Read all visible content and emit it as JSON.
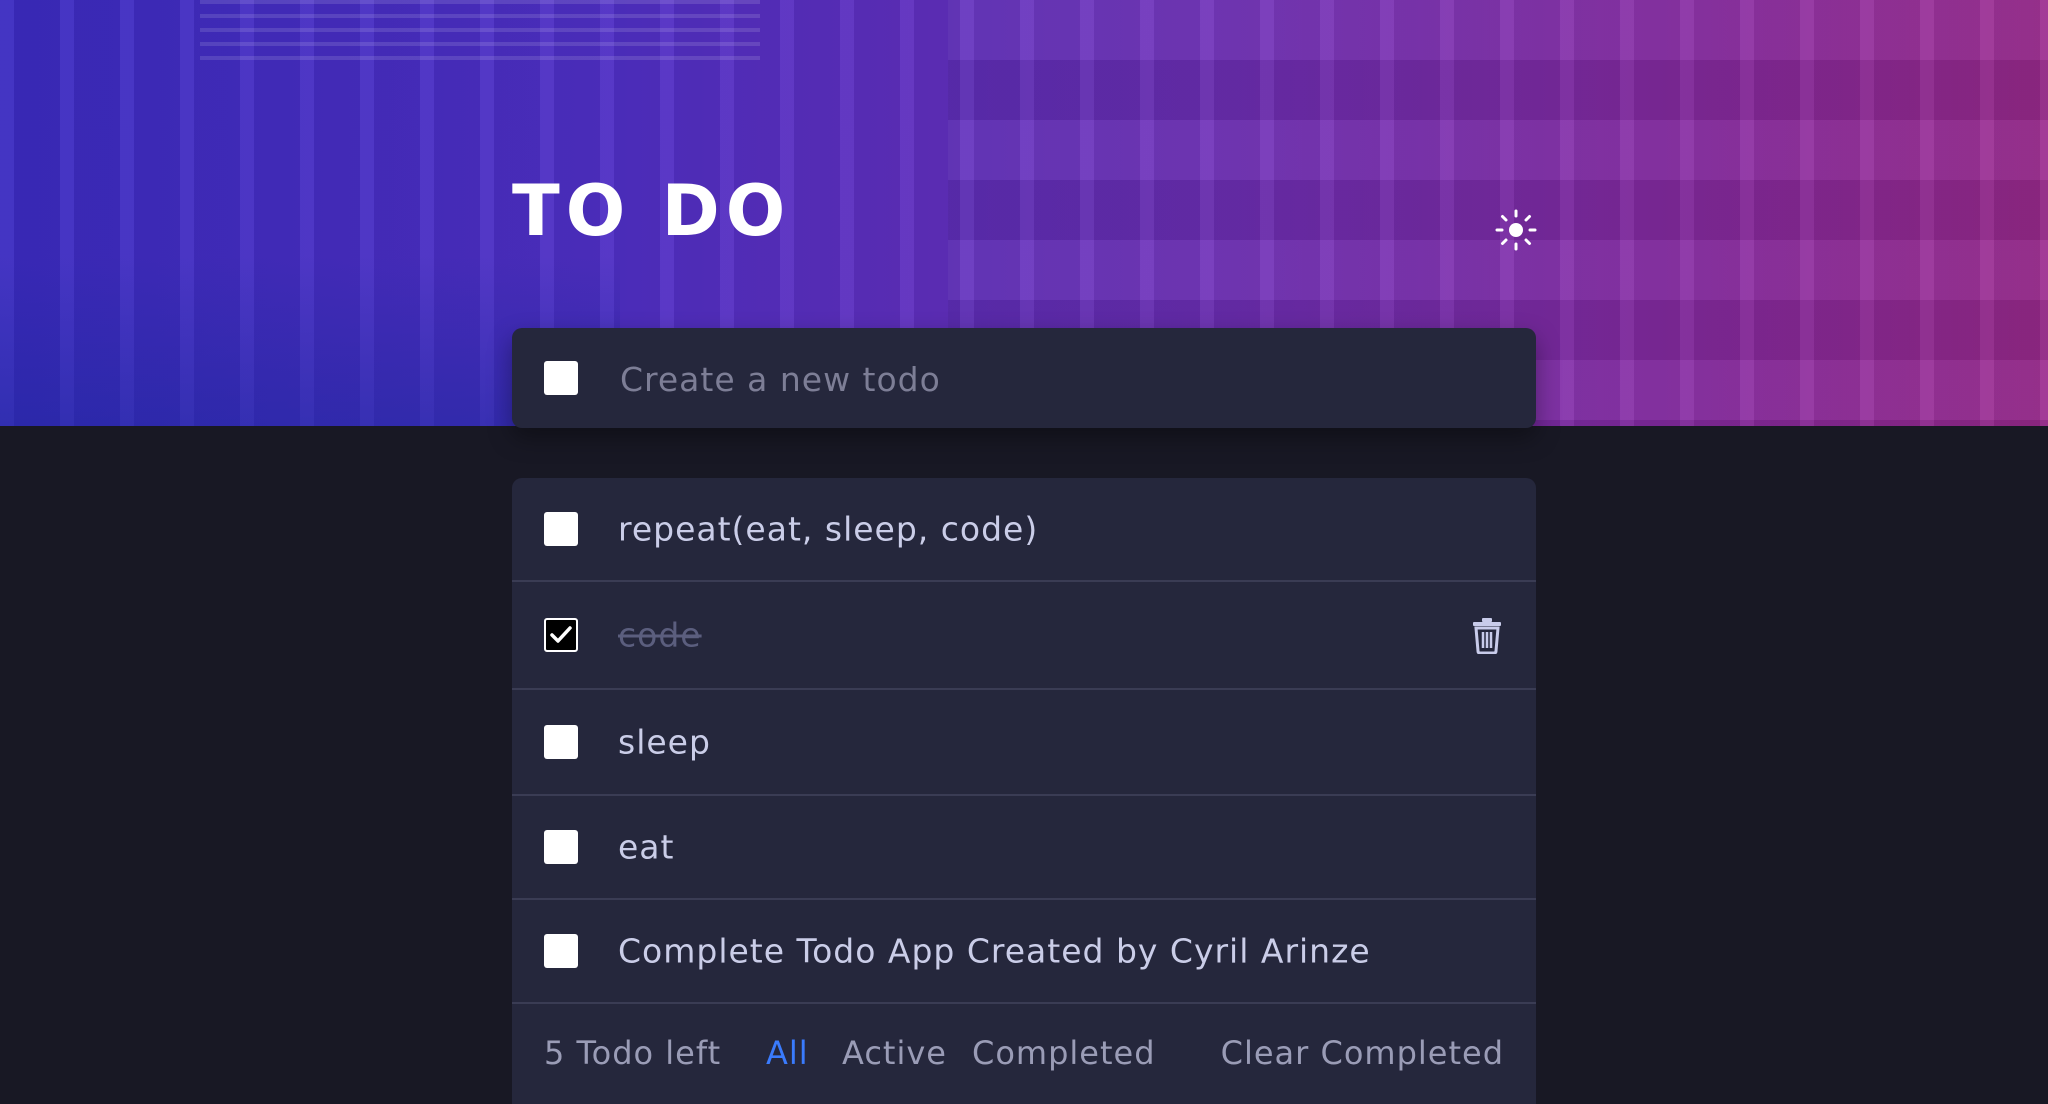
{
  "header": {
    "title": "TO DO",
    "theme_toggle_icon": "sun-icon"
  },
  "new_todo": {
    "placeholder": "Create a new todo",
    "value": ""
  },
  "todos": [
    {
      "label": "repeat(eat, sleep, code)",
      "completed": false
    },
    {
      "label": "code",
      "completed": true
    },
    {
      "label": "sleep",
      "completed": false
    },
    {
      "label": "eat",
      "completed": false
    },
    {
      "label": "Complete Todo App Created by Cyril Arinze",
      "completed": false
    }
  ],
  "footer": {
    "count_text": "5 Todo left",
    "filters": {
      "all": "All",
      "active": "Active",
      "completed": "Completed"
    },
    "active_filter": "all",
    "clear_label": "Clear Completed"
  },
  "colors": {
    "accent": "#3a7bfd",
    "card": "#25273c",
    "page_bg": "#181824"
  },
  "icons": {
    "delete": "trash-icon",
    "check": "checkmark-icon"
  }
}
